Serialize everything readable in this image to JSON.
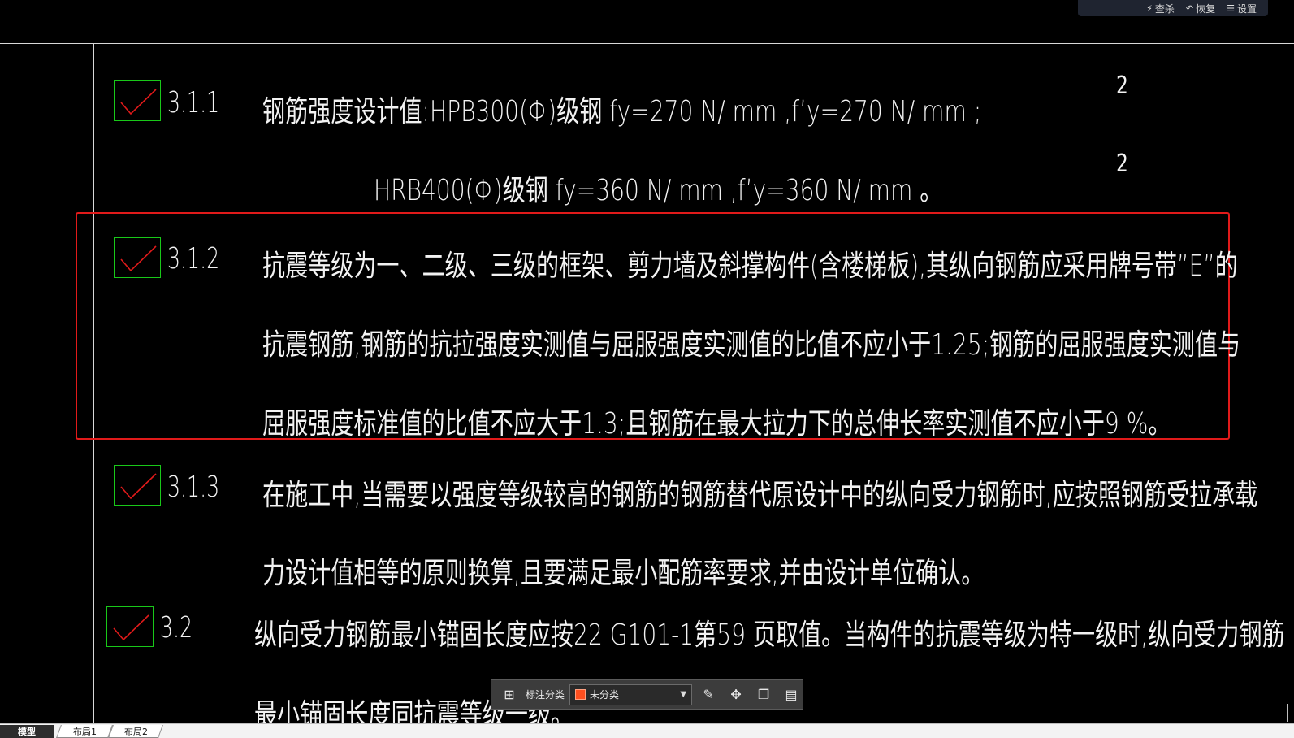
{
  "toolbar": {
    "kill_label": "查杀",
    "restore_label": "恢复",
    "settings_label": "设置"
  },
  "items": [
    {
      "number": "3.1.1",
      "lines": [
        "钢筋强度设计值:HPB300(Φ)级钢 fy=270 N/ mm ,f’y=270 N/ mm ;",
        "HRB400(Φ)级钢 fy=360 N/ mm ,f’y=360 N/ mm 。"
      ],
      "superscripts": [
        "2",
        "2"
      ]
    },
    {
      "number": "3.1.2",
      "lines": [
        "抗震等级为一、二级、三级的框架、剪力墙及斜撑构件(含楼梯板),其纵向钢筋应采用牌号带”E”的",
        "抗震钢筋,钢筋的抗拉强度实测值与屈服强度实测值的比值不应小于1.25;钢筋的屈服强度实测值与",
        "屈服强度标准值的比值不应大于1.3;且钢筋在最大拉力下的总伸长率实测值不应小于9 %。"
      ]
    },
    {
      "number": "3.1.3",
      "lines": [
        "在施工中,当需要以强度等级较高的钢筋的钢筋替代原设计中的纵向受力钢筋时,应按照钢筋受拉承载",
        "力设计值相等的原则换算,且要满足最小配筋率要求,并由设计单位确认。"
      ]
    },
    {
      "number": "3.2",
      "lines": [
        "纵向受力钢筋最小锚固长度应按22 G101-1第59 页取值。当构件的抗震等级为特一级时,纵向受力钢筋",
        "最小锚固长度同抗震等级一级。"
      ]
    }
  ],
  "annotation_toolbar": {
    "label": "标注分类",
    "selected": "未分类",
    "swatch_color": "#ff4f1f"
  },
  "tabs": [
    "模型",
    "布局1",
    "布局2"
  ],
  "colors": {
    "check_box": "#19c819",
    "check_mark": "#e11a1a",
    "highlight_frame": "#e11a1a"
  }
}
